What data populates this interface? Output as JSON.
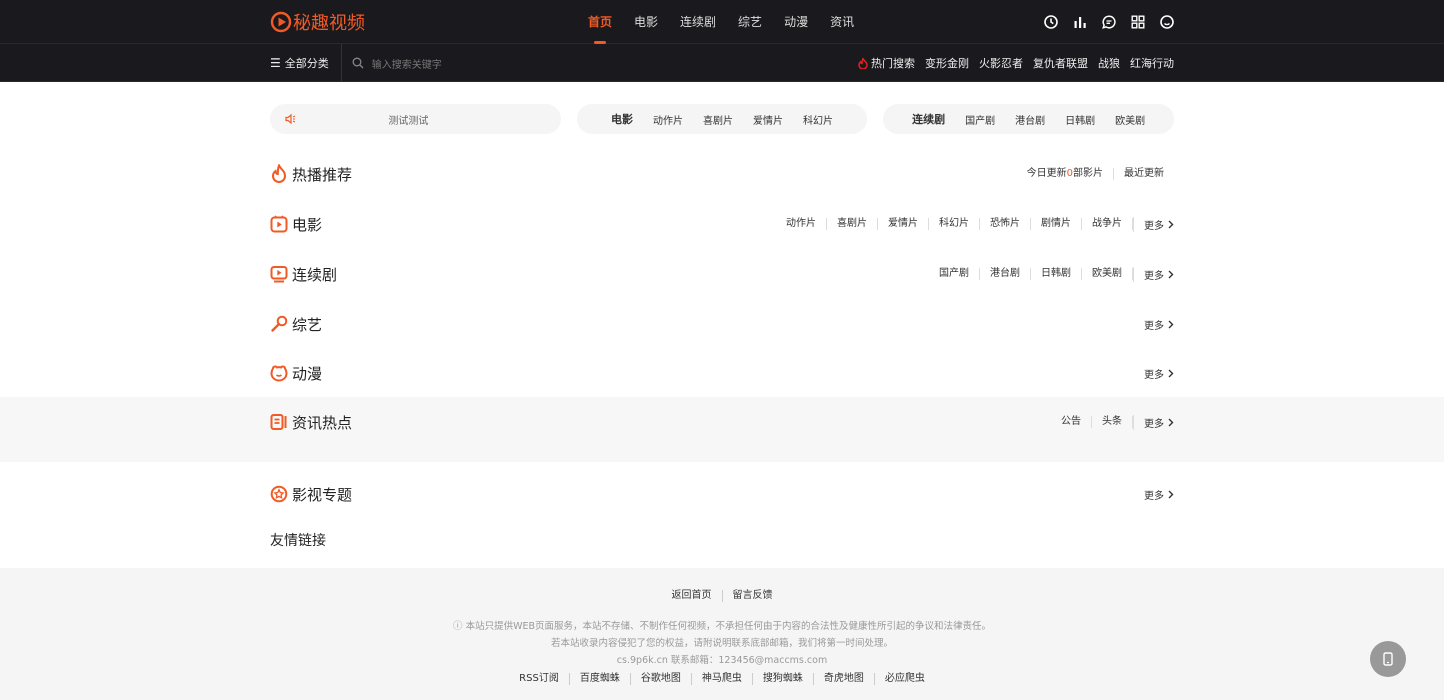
{
  "brand": {
    "name": "秘趣视频",
    "color": "#f15a24"
  },
  "nav": {
    "items": [
      "首页",
      "电影",
      "连续剧",
      "综艺",
      "动漫",
      "资讯"
    ],
    "active": 0
  },
  "top_icons": [
    "history-icon",
    "chart-icon",
    "message-icon",
    "qrcode-icon",
    "user-icon"
  ],
  "subbar": {
    "all_categories": "全部分类",
    "search_placeholder": "输入搜索关键字",
    "hot_label": "热门搜索",
    "hot_items": [
      "变形金刚",
      "火影忍者",
      "复仇者联盟",
      "战狼",
      "红海行动"
    ]
  },
  "notice": {
    "text": "测试测试"
  },
  "chip_movie": {
    "title": "电影",
    "items": [
      "动作片",
      "喜剧片",
      "爱情片",
      "科幻片"
    ]
  },
  "chip_series": {
    "title": "连续剧",
    "items": [
      "国产剧",
      "港台剧",
      "日韩剧",
      "欧美剧"
    ]
  },
  "sections": {
    "hot": {
      "title": "热播推荐",
      "update_prefix": "今日更新",
      "update_count": "0",
      "update_suffix": "部影片",
      "recent": "最近更新"
    },
    "movie": {
      "title": "电影",
      "links": [
        "动作片",
        "喜剧片",
        "爱情片",
        "科幻片",
        "恐怖片",
        "剧情片",
        "战争片"
      ],
      "more": "更多"
    },
    "series": {
      "title": "连续剧",
      "links": [
        "国产剧",
        "港台剧",
        "日韩剧",
        "欧美剧"
      ],
      "more": "更多"
    },
    "variety": {
      "title": "综艺",
      "more": "更多"
    },
    "anime": {
      "title": "动漫",
      "more": "更多"
    },
    "news": {
      "title": "资讯热点",
      "links": [
        "公告",
        "头条"
      ],
      "more": "更多"
    },
    "topic": {
      "title": "影视专题",
      "more": "更多"
    }
  },
  "friends": {
    "title": "友情链接"
  },
  "footer": {
    "links": [
      "返回首页",
      "留言反馈"
    ],
    "notice1": "本站只提供WEB页面服务，本站不存储、不制作任何视频，不承担任何由于内容的合法性及健康性所引起的争议和法律责任。",
    "notice2": "若本站收录内容侵犯了您的权益，请附说明联系底部邮箱，我们将第一时间处理。",
    "contact": "cs.9p6k.cn 联系邮箱：123456@maccms.com",
    "bottom_links": [
      "RSS订阅",
      "百度蜘蛛",
      "谷歌地图",
      "神马爬虫",
      "搜狗蜘蛛",
      "奇虎地图",
      "必应爬虫"
    ]
  }
}
